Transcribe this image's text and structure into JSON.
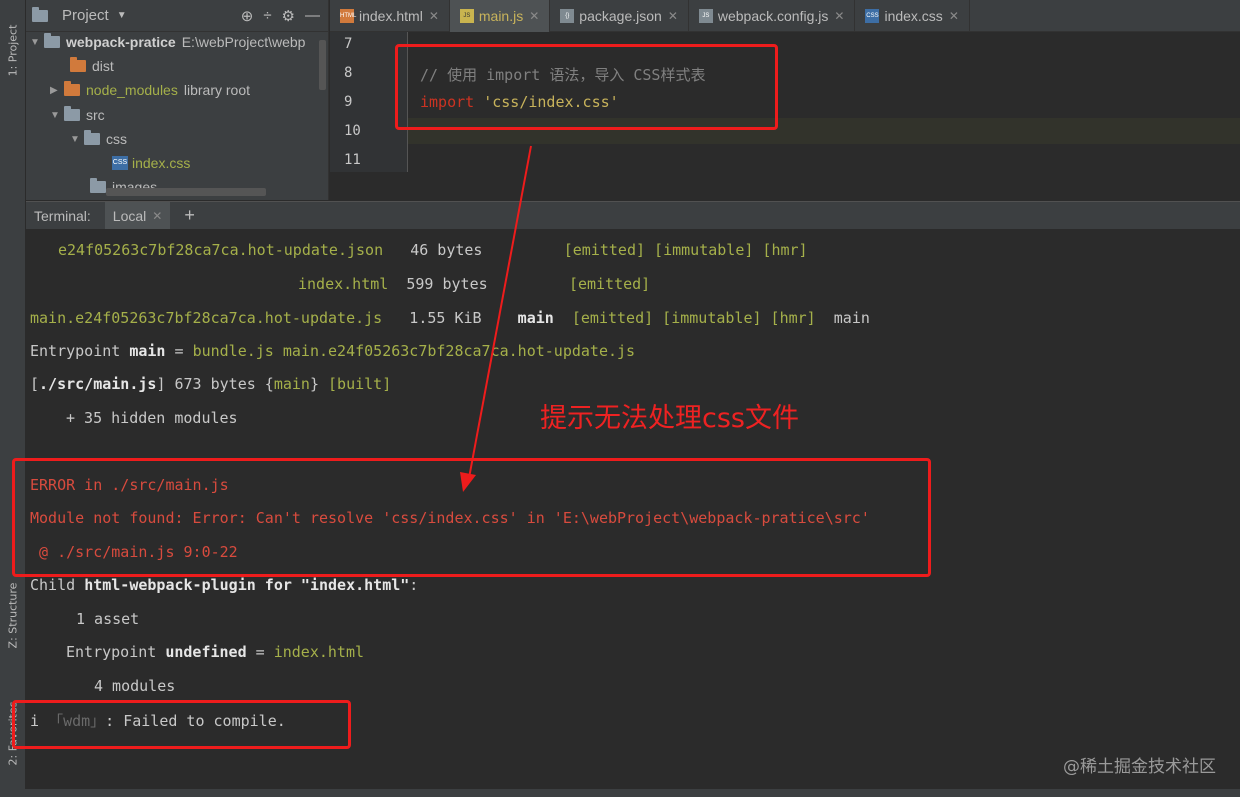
{
  "sidebar": {
    "project_tool": "1: Project",
    "structure_tool": "Z: Structure",
    "favorites_tool": "2: Favorites"
  },
  "project": {
    "title": "Project",
    "root": {
      "name": "webpack-pratice",
      "path": "E:\\webProject\\webp"
    },
    "items": [
      {
        "name": "dist"
      },
      {
        "name": "node_modules",
        "suffix": "library root"
      },
      {
        "name": "src"
      },
      {
        "name": "css"
      },
      {
        "name": "index.css"
      },
      {
        "name": "images"
      }
    ]
  },
  "editor": {
    "tabs": [
      {
        "label": "index.html"
      },
      {
        "label": "main.js",
        "active": true
      },
      {
        "label": "package.json"
      },
      {
        "label": "webpack.config.js"
      },
      {
        "label": "index.css"
      }
    ],
    "line_numbers": [
      "7",
      "8",
      "9",
      "10",
      "11"
    ],
    "code": {
      "comment": "// 使用 import 语法，导入 CSS样式表",
      "import_kw": "import",
      "import_str": "'css/index.css'"
    }
  },
  "terminal": {
    "label": "Terminal:",
    "tab": "Local",
    "lines": {
      "l1_file": "e24f05263c7bf28ca7ca.hot-update.json",
      "l1_size": "46 bytes",
      "l1_tags": "[emitted] [immutable] [hmr]",
      "l2_file": "index.html",
      "l2_size": "599 bytes",
      "l2_tags": "[emitted]",
      "l3_file": "main.e24f05263c7bf28ca7ca.hot-update.js",
      "l3_size": "1.55 KiB",
      "l3_chunk": "main",
      "l3_tags": "[emitted] [immutable] [hmr]",
      "l3_name": "main",
      "l4_a": "Entrypoint ",
      "l4_b": "main",
      "l4_c": " = ",
      "l4_d": "bundle.js main.e24f05263c7bf28ca7ca.hot-update.js",
      "l5_a": "[",
      "l5_b": "./src/main.js",
      "l5_c": "] 673 bytes {",
      "l5_d": "main",
      "l5_e": "} ",
      "l5_f": "[built]",
      "l6": "+ 35 hidden modules",
      "err1": "ERROR in ./src/main.js",
      "err2": "Module not found: Error: Can't resolve 'css/index.css' in 'E:\\webProject\\webpack-pratice\\src'",
      "err3": " @ ./src/main.js 9:0-22",
      "c1_a": "Child ",
      "c1_b": "html-webpack-plugin for \"index.html\"",
      "c1_c": ":",
      "c2": "1 asset",
      "c3_a": "Entrypoint ",
      "c3_b": "undefined",
      "c3_c": " = ",
      "c3_d": "index.html",
      "c4": "4 modules",
      "f_a": "i ",
      "f_b": "「wdm」",
      "f_c": ": Failed to compile."
    }
  },
  "annotation": "提示无法处理css文件",
  "watermark": "@稀土掘金技术社区",
  "colors": {
    "annotation_red": "#ee1c1c",
    "accent_yellow": "#a5b04a"
  }
}
